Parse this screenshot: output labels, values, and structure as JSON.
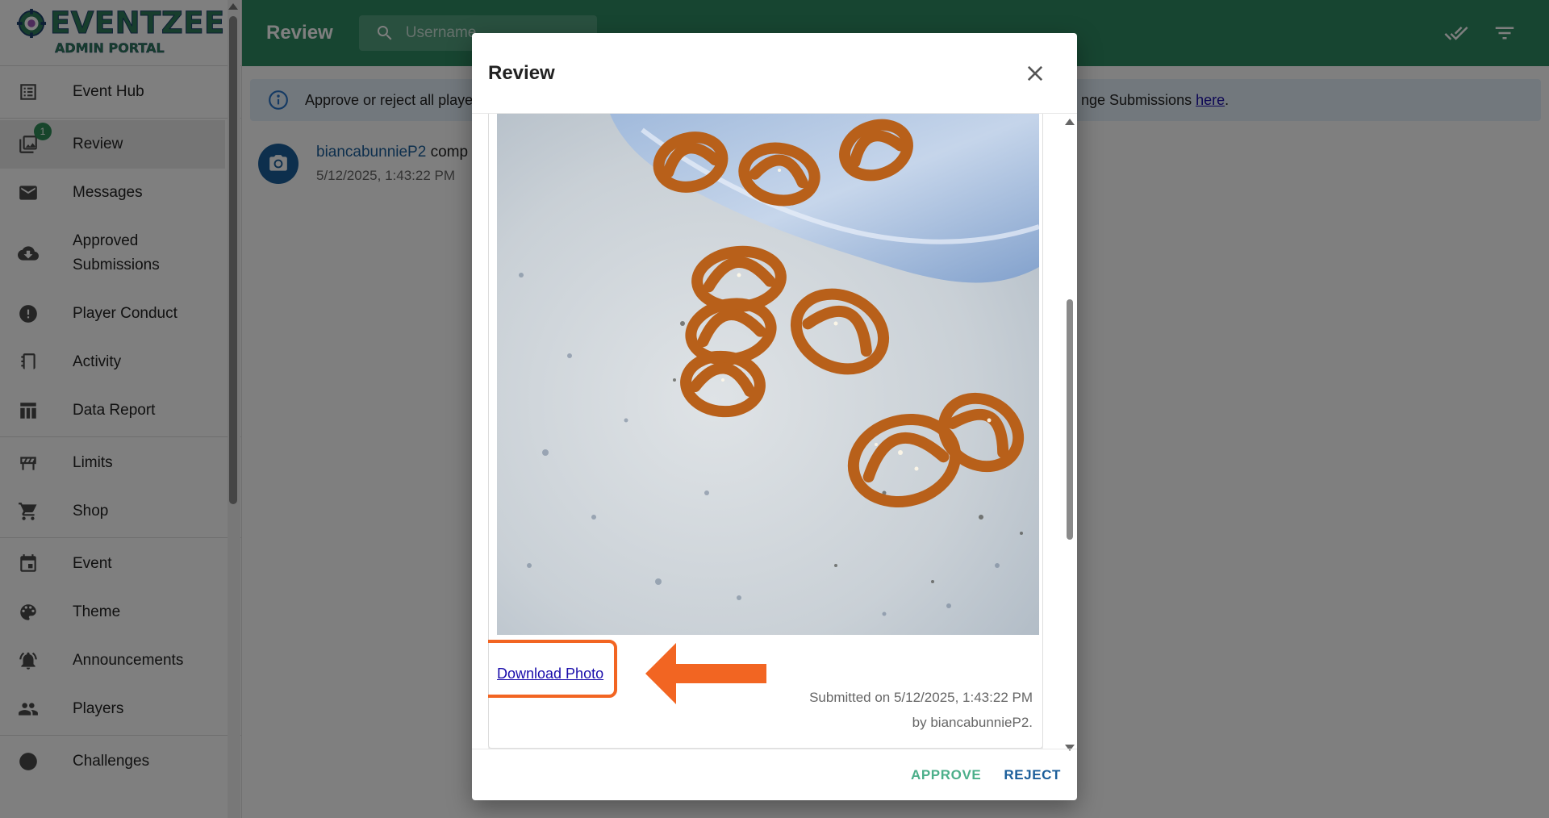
{
  "logo": {
    "title": "EVENTZEE",
    "subtitle": "ADMIN PORTAL"
  },
  "sidebar": {
    "groups": [
      [
        {
          "label": "Event Hub",
          "icon": "list-icon"
        }
      ],
      [
        {
          "label": "Review",
          "icon": "photo-review-icon",
          "badge": "1",
          "active": true
        },
        {
          "label": "Messages",
          "icon": "mail-icon"
        },
        {
          "label": "Approved Submissions",
          "icon": "cloud-download-icon"
        },
        {
          "label": "Player Conduct",
          "icon": "alert-icon"
        },
        {
          "label": "Activity",
          "icon": "notebook-icon"
        },
        {
          "label": "Data Report",
          "icon": "table-icon"
        }
      ],
      [
        {
          "label": "Limits",
          "icon": "roadblock-icon"
        },
        {
          "label": "Shop",
          "icon": "cart-icon"
        }
      ],
      [
        {
          "label": "Event",
          "icon": "calendar-icon"
        },
        {
          "label": "Theme",
          "icon": "palette-icon"
        },
        {
          "label": "Announcements",
          "icon": "bell-alert-icon"
        },
        {
          "label": "Players",
          "icon": "people-icon"
        }
      ],
      [
        {
          "label": "Challenges",
          "icon": "challenges-icon"
        }
      ]
    ]
  },
  "header": {
    "title": "Review",
    "search_placeholder": "Username"
  },
  "banner": {
    "left_text": "Approve or reject all player",
    "right_text": "nge Submissions ",
    "link_text": "here",
    "period": "."
  },
  "feed": {
    "username": "biancabunnieP2",
    "action_partial": " comp",
    "timestamp": "5/12/2025, 1:43:22 PM"
  },
  "modal": {
    "title": "Review",
    "download_label": "Download Photo",
    "submitted_line": "Submitted on 5/12/2025, 1:43:22 PM",
    "by_line": "by biancabunnieP2.",
    "approve_label": "APPROVE",
    "reject_label": "REJECT"
  },
  "colors": {
    "primary": "#2e8b62",
    "link": "#1a0dab",
    "highlight": "#f26522",
    "approve": "#4caf8a",
    "reject": "#1b5e9a"
  }
}
